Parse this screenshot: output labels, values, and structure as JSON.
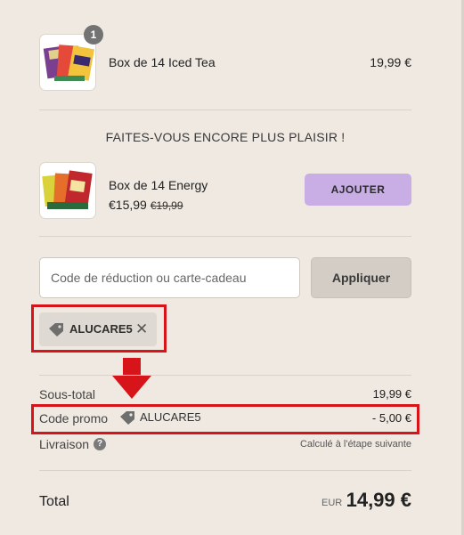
{
  "cart": {
    "item": {
      "name": "Box de 14 Iced Tea",
      "price": "19,99 €",
      "quantity": "1"
    }
  },
  "upsell": {
    "title": "FAITES-VOUS ENCORE PLUS PLAISIR !",
    "item": {
      "name": "Box de 14 Energy",
      "price": "€15,99",
      "compare_price": "€19,99",
      "button_label": "AJOUTER"
    }
  },
  "discount": {
    "placeholder": "Code de réduction ou carte-cadeau",
    "value": "",
    "apply_label": "Appliquer",
    "applied_code": "ALUCARE5"
  },
  "summary": {
    "subtotal_label": "Sous-total",
    "subtotal_value": "19,99 €",
    "promo_label": "Code promo",
    "promo_code": "ALUCARE5",
    "promo_value": "- 5,00 €",
    "shipping_label": "Livraison",
    "shipping_help": "?",
    "shipping_value": "Calculé à l'étape suivante",
    "total_label": "Total",
    "currency": "EUR",
    "total_value": "14,99 €"
  },
  "colors": {
    "background": "#efe9e1",
    "add_button": "#c9aee6",
    "annotation_red": "#d8141b"
  },
  "icons": [
    "tag-icon",
    "close-icon",
    "help-icon",
    "down-arrow-annotation"
  ]
}
